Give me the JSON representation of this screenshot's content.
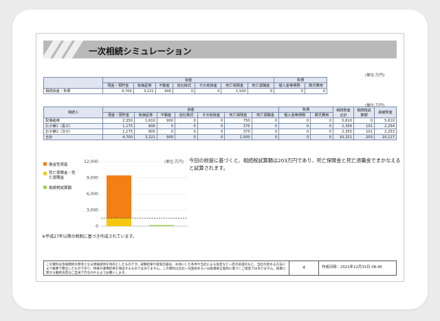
{
  "title": "一次相続シミュレーション",
  "unit_label": "(単位:万円)",
  "chart_unit_label": "(単位:万円)",
  "table1": {
    "group_asset": "資産",
    "group_liability": "負債",
    "headers": [
      "現金・預貯金",
      "有価証券",
      "不動産",
      "自社株式",
      "その他資産",
      "死亡保険金",
      "死亡退職金",
      "借入金等債務",
      "葬式費用"
    ],
    "row_label": "相続資産・負債",
    "values": [
      "4,700",
      "3,221",
      "900",
      "0",
      "0",
      "1,500",
      "0",
      "0",
      "0"
    ]
  },
  "table2": {
    "col_heir": "相続人",
    "group_asset": "資産",
    "group_liability": "負債",
    "headers": [
      "現金・預貯金",
      "有価証券",
      "不動産",
      "自社株式",
      "その他資産",
      "死亡保険金",
      "死亡退職金",
      "借入金等債務",
      "葬式費用"
    ],
    "col_after_tax": "相続財産合計",
    "col_tax": "相続税試算額",
    "col_net": "承継財産",
    "rows": [
      {
        "name": "配偶者様",
        "values": [
          "2,350",
          "1,610",
          "900",
          "0",
          "0",
          "750",
          "0",
          "0",
          "0"
        ],
        "total": "5,610",
        "tax": "0",
        "net": "5,610"
      },
      {
        "name": "お子様1（長子）",
        "values": [
          "1,175",
          "806",
          "0",
          "0",
          "0",
          "375",
          "0",
          "0",
          "0"
        ],
        "total": "2,356",
        "tax": "101",
        "net": "2,254"
      },
      {
        "name": "お子様2（次子）",
        "values": [
          "1,175",
          "805",
          "0",
          "0",
          "0",
          "375",
          "0",
          "0",
          "0"
        ],
        "total": "2,355",
        "tax": "101",
        "net": "2,253"
      },
      {
        "name": "合計",
        "values": [
          "4,700",
          "3,221",
          "900",
          "0",
          "0",
          "1,500",
          "0",
          "0",
          "0"
        ],
        "total": "10,321",
        "tax": "203",
        "net": "10,117"
      }
    ]
  },
  "legend": [
    {
      "label": "換金性資産",
      "color": "#f47f12"
    },
    {
      "label": "死亡保険金・死亡退職金",
      "color": "#f5c80f"
    },
    {
      "label": "相続税試算額",
      "color": "#a3cf5a"
    }
  ],
  "chart_data": {
    "type": "bar",
    "stacked": true,
    "categories": [
      "",
      ""
    ],
    "series": [
      {
        "name": "死亡保険金・死亡退職金",
        "values": [
          1500,
          0
        ],
        "color": "#f5c80f"
      },
      {
        "name": "換金性資産",
        "values": [
          7921,
          0
        ],
        "color": "#f47f12"
      },
      {
        "name": "相続税試算額",
        "values": [
          0,
          203
        ],
        "color": "#a3cf5a"
      }
    ],
    "yticks": [
      "12,000",
      "9,000",
      "6,000",
      "3,000",
      "0"
    ],
    "ylim": [
      0,
      12000
    ],
    "reference_line": 1500
  },
  "comment": "今回の前提に基づくと、相続税試算額は203万円であり、死亡保険金と死亡退職金でまかなえると試算されます。",
  "note": "※平成27年以降の税制に基づき作成されています。",
  "footer": {
    "disclaimer": "この資料は皆様相続の参考となる情報提供を目的としたものです。試算結果や提案内容は、お伺いした条件や当社による仮定など一定の前提のもと、当社の定める方法により概算で算出したものであり、将来の運用結果を保証するものではありません。この資料は当社一任契約あるいは投資助言契約に基づくご提案ではありません。投資に関する最終決定はご自身で行なわれるようお願いします。",
    "page": "4",
    "date": "作成日時：2021年12月15日 08:45"
  }
}
